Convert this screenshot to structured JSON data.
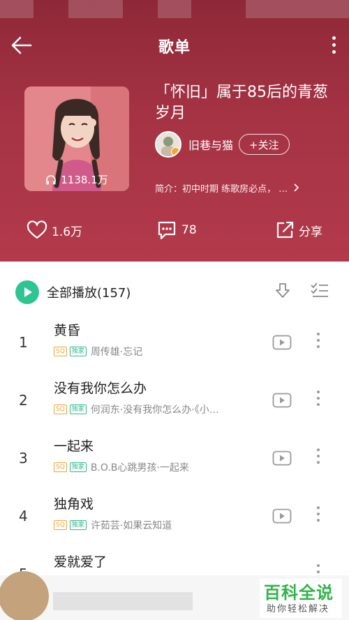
{
  "nav": {
    "title": "歌单"
  },
  "playlist": {
    "title": "「怀旧」属于85后的青葱岁月",
    "play_count": "1138.1万",
    "creator": {
      "name": "旧巷与猫",
      "follow_label": "+关注"
    },
    "intro": "简介：初中时期 练歌房必点，"
  },
  "actions": {
    "like_count": "1.6万",
    "comment_count": "78",
    "share_label": "分享"
  },
  "list": {
    "play_all_label": "全部播放(157)",
    "tag_sq": "SQ",
    "tag_exclusive": "独家",
    "songs": [
      {
        "index": "1",
        "name": "黄昏",
        "artist": "周传雄·忘记"
      },
      {
        "index": "2",
        "name": "没有我你怎么办",
        "artist": "何润东·没有我你怎么办·《小…"
      },
      {
        "index": "3",
        "name": "一起来",
        "artist": "B.O.B心跳男孩·一起来"
      },
      {
        "index": "4",
        "name": "独角戏",
        "artist": "许茹芸·如果云知道"
      },
      {
        "index": "5",
        "name": "爱就爱了",
        "artist": ""
      }
    ]
  },
  "watermark": {
    "main": "百科全说",
    "sub": "助你轻松解决"
  },
  "colors": {
    "header_bg": "#a53344",
    "accent_green": "#2fc592",
    "tag_sq": "#e9a73b",
    "tag_exclusive": "#2fb98b"
  }
}
